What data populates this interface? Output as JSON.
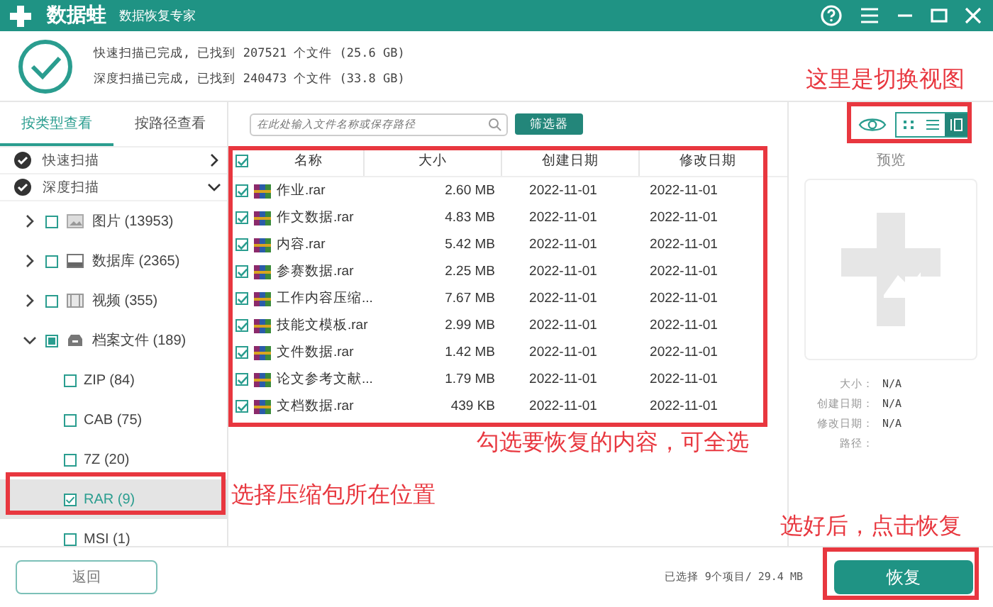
{
  "title_bar": {
    "app_name": "数据蛙",
    "subtitle": "数据恢复专家"
  },
  "scan_summary": [
    "快速扫描已完成, 已找到 207521 个文件 (25.6 GB)",
    "深度扫描已完成, 已找到 240473 个文件 (33.8 GB)"
  ],
  "view_tabs": [
    {
      "label": "按类型查看",
      "selected": true
    },
    {
      "label": "按路径查看",
      "selected": false
    }
  ],
  "scans": [
    {
      "label": "快速扫描",
      "expanded": false
    },
    {
      "label": "深度扫描",
      "expanded": true
    }
  ],
  "tree": [
    {
      "kind": "image",
      "label": "图片 (13953)",
      "expanded": false,
      "partial": false
    },
    {
      "kind": "database",
      "label": "数据库 (2365)",
      "expanded": false,
      "partial": false
    },
    {
      "kind": "video",
      "label": "视频 (355)",
      "expanded": false,
      "partial": false
    },
    {
      "kind": "archive",
      "label": "档案文件 (189)",
      "expanded": true,
      "partial": true,
      "children": [
        {
          "label": "ZIP (84)",
          "checked": false,
          "selected": false
        },
        {
          "label": "CAB (75)",
          "checked": false,
          "selected": false
        },
        {
          "label": "7Z (20)",
          "checked": false,
          "selected": false
        },
        {
          "label": "RAR (9)",
          "checked": true,
          "selected": true
        },
        {
          "label": "MSI (1)",
          "checked": false,
          "selected": false
        }
      ]
    }
  ],
  "search": {
    "placeholder": "在此处输入文件名称或保存路径"
  },
  "filter_button": "筛选器",
  "view_modes": [
    {
      "kind": "grid",
      "selected": false
    },
    {
      "kind": "list",
      "selected": false
    },
    {
      "kind": "detail",
      "selected": true
    }
  ],
  "table": {
    "all_checked": true,
    "columns": [
      "名称",
      "大小",
      "创建日期",
      "修改日期"
    ],
    "rows": [
      {
        "checked": true,
        "name": "作业.rar",
        "size": "2.60 MB",
        "created": "2022-11-01",
        "modified": "2022-11-01"
      },
      {
        "checked": true,
        "name": "作文数据.rar",
        "size": "4.83 MB",
        "created": "2022-11-01",
        "modified": "2022-11-01"
      },
      {
        "checked": true,
        "name": "内容.rar",
        "size": "5.42 MB",
        "created": "2022-11-01",
        "modified": "2022-11-01"
      },
      {
        "checked": true,
        "name": "参赛数据.rar",
        "size": "2.25 MB",
        "created": "2022-11-01",
        "modified": "2022-11-01"
      },
      {
        "checked": true,
        "name": "工作内容压缩...",
        "size": "7.67 MB",
        "created": "2022-11-01",
        "modified": "2022-11-01"
      },
      {
        "checked": true,
        "name": "技能文模板.rar",
        "size": "2.99 MB",
        "created": "2022-11-01",
        "modified": "2022-11-01"
      },
      {
        "checked": true,
        "name": "文件数据.rar",
        "size": "1.42 MB",
        "created": "2022-11-01",
        "modified": "2022-11-01"
      },
      {
        "checked": true,
        "name": "论文参考文献...",
        "size": "1.79 MB",
        "created": "2022-11-01",
        "modified": "2022-11-01"
      },
      {
        "checked": true,
        "name": "文档数据.rar",
        "size": "439 KB",
        "created": "2022-11-01",
        "modified": "2022-11-01"
      }
    ]
  },
  "preview": {
    "title": "预览",
    "fields": [
      {
        "label": "大小：",
        "value": "N/A"
      },
      {
        "label": "创建日期：",
        "value": "N/A"
      },
      {
        "label": "修改日期：",
        "value": "N/A"
      },
      {
        "label": "路径："
      }
    ]
  },
  "footer": {
    "back_button": "返回",
    "selection_status": "已选择 9个项目/ 29.4 MB",
    "restore_button": "恢复"
  },
  "annotations": [
    {
      "text": "这里是切换视图"
    },
    {
      "text": "勾选要恢复的内容，可全选"
    },
    {
      "text": "选择压缩包所在位置"
    },
    {
      "text": "选好后，点击恢复"
    }
  ]
}
